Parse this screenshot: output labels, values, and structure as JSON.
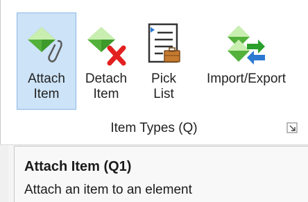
{
  "ribbon": {
    "buttons": [
      {
        "label_line1": "Attach",
        "label_line2": "Item",
        "icon": "attach-item-icon"
      },
      {
        "label_line1": "Detach",
        "label_line2": "Item",
        "icon": "detach-item-icon"
      },
      {
        "label_line1": "Pick",
        "label_line2": "List",
        "icon": "pick-list-icon"
      },
      {
        "label_line1": "Import/Export",
        "label_line2": "",
        "icon": "import-export-icon"
      }
    ],
    "group_title": "Item Types (Q)"
  },
  "tooltip": {
    "title": "Attach Item (Q1)",
    "description": "Attach an item to an element"
  },
  "colors": {
    "diamond_top": "#c9efb0",
    "diamond_bottom": "#53b13c",
    "red_x": "#e32020",
    "active_bg": "#cde3f7",
    "active_border": "#8ab8e6",
    "blue_arrow": "#2a78d1"
  }
}
